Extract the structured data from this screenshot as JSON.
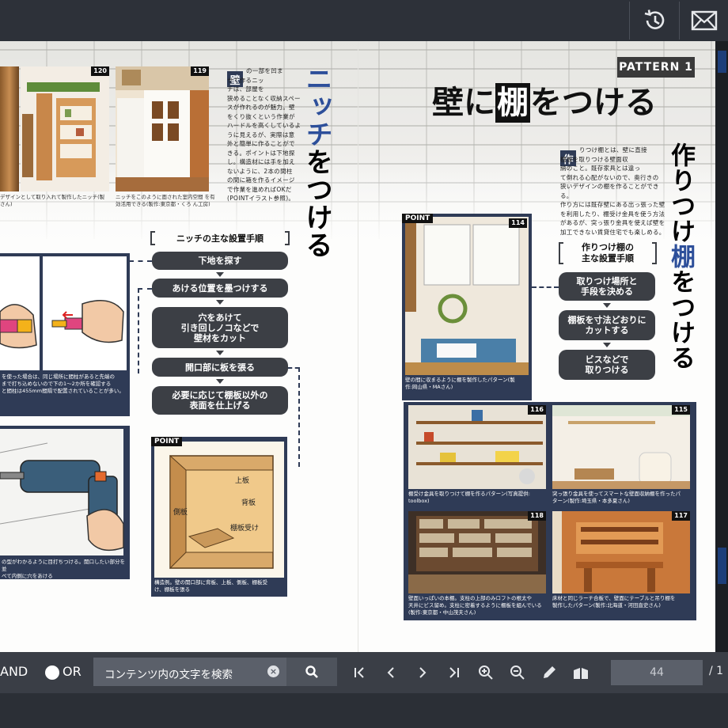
{
  "topbar": {
    "history_label": "history",
    "mail_label": "mail"
  },
  "left_page": {
    "photo_120_tag": "120",
    "photo_119_tag": "119",
    "caption_120": "デザインとして取り入れて製作したニッチ(製\nさん)",
    "caption_119": "ニッチをこのように面された室内空間\nを有効活用できる(製作:東京都・くろ\nん工房)",
    "dropcap": "壁",
    "intro_text": "の一部を凹ま\nせて作るニッ\nチは、部屋を\n狭めることなく収納スペー\nスが作れるのが魅力。壁\nをくり抜くという作業が\nハードルを高くしているよ\nうに見えるが、実際は意\n外と簡単に作ることがで\nきる。ポイントは下地探\nし。構造材には手を加え\nないように、2本の間柱\nの間に箱を作るイメージ\nで作業を進めればOKだ\n(POINTイラスト参照)。",
    "vertical_title_blue": "ニッチ",
    "vertical_title_black": "をつける",
    "steps_title": "ニッチの主な設置手順",
    "steps": [
      "下地を探す",
      "あける位置を墨つけする",
      "穴をあけて\n引き回しノコなどで\n壁材をカット",
      "開口部に板を張る",
      "必要に応じて棚板以外の\n表面を仕上げる"
    ],
    "illus1_caption": "を使った場合は、同じ場所に間柱があると先端の\nまで打ち込めないので下の1〜2か所を確認する\nと間柱は455mm間隔で配置されていることが多い。",
    "illus2_caption": "の型がわかるように目打ちつける。開口したい部分を並\nべて内側に穴をあける",
    "point_tag": "POINT",
    "point_labels": {
      "top": "上板",
      "back": "背板",
      "side": "側板",
      "shelf": "棚板受け"
    },
    "point_caption": "構造例。壁の開口部に背板、上板、側板、棚板受\nけ、棚板を張る"
  },
  "right_page": {
    "pattern_label": "PATTERN 1",
    "headline_pre": "壁に",
    "headline_box": "棚",
    "headline_post": "をつける",
    "dropcap": "作",
    "intro_text": "りつけ棚とは、壁に直接\n棚板を取りつける壁面収\n納のこと。既存家具とは違っ\nて倒れる心配がないので、奥行きの\n狭いデザインの棚を作ることができる。\n作り方には既存壁にある出っ張った壁\nを利用したり、棚受け金具を使う方法\nがあるが、突っ張り金具を使えば壁を\n加工できない賃貸住宅でも楽しめる。",
    "vertical_title_black1": "作りつけ",
    "vertical_title_blue": "棚",
    "vertical_title_black2": "をつける",
    "steps_title": "作りつけ棚の\n主な設置手順",
    "steps": [
      "取りつけ場所と\n手段を決める",
      "棚板を寸法どおりに\nカットする",
      "ビスなどで\n取りつける"
    ],
    "point_tag": "POINT",
    "photo_114_tag": "114",
    "caption_114": "壁の間に収まるように棚を製作したパターン(製\n作:岡山県・MAさん)",
    "photo_116_tag": "116",
    "caption_116": "棚受け金具を取りつけて棚を作るパターン(写真提供:\ntoolbox)",
    "photo_115_tag": "115",
    "caption_115": "突っ張り金具を使ってスマートな壁面収納棚を作ったパ\nターン(製作:埼玉県・本多夏さん)",
    "photo_118_tag": "118",
    "caption_118": "壁面いっぱいの本棚。支柱の上部のみロフトの根太や\n天井にビス留め。支柱に密着するように棚板を組んでいる\n(製作:東京都・中山茂夫さん)",
    "photo_117_tag": "117",
    "caption_117": "床材と同じラーチ合板で、壁面にテーブルと吊り棚を\n製作したパターン(製作:北海道・河田直史さん)"
  },
  "toolbar": {
    "and_label": "AND",
    "or_label": "OR",
    "search_placeholder": "コンテンツ内の文字を検索",
    "clear_glyph": "×",
    "current_page": "44",
    "total_prefix": "/ 1"
  }
}
